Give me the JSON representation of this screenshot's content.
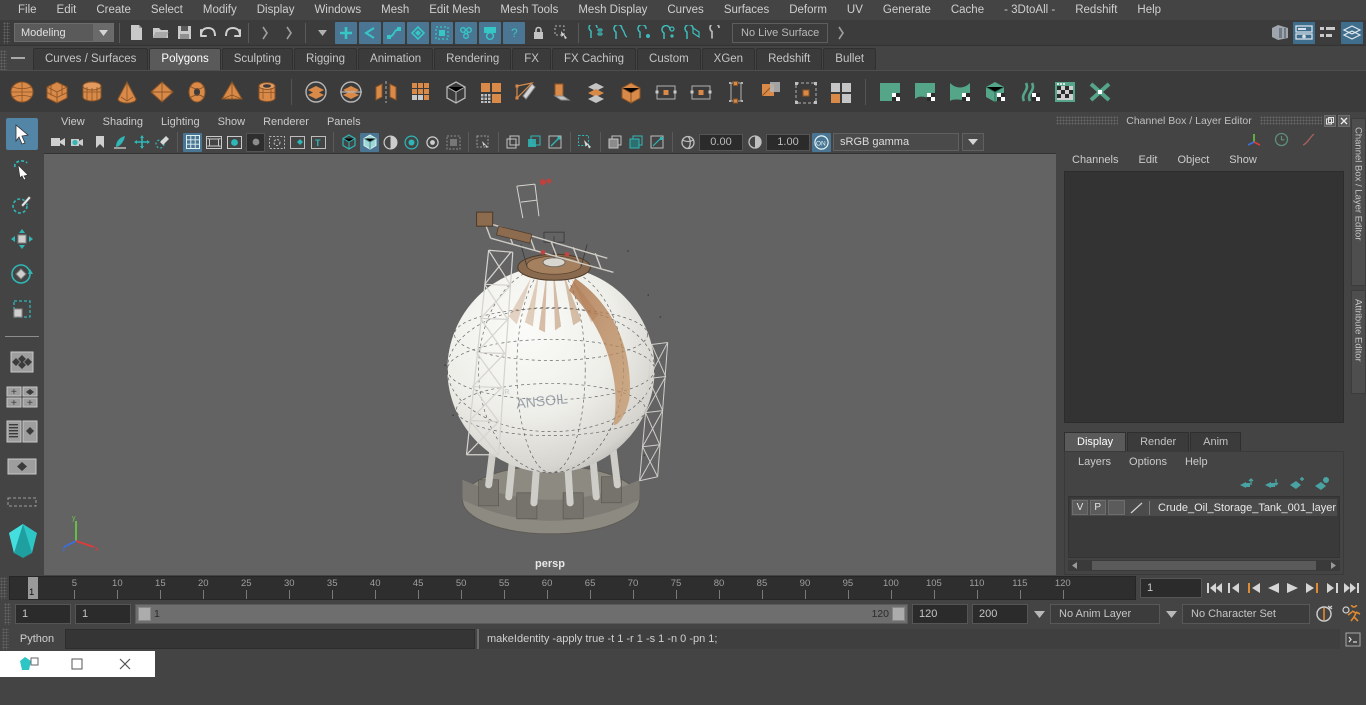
{
  "menubar": {
    "items": [
      "File",
      "Edit",
      "Create",
      "Select",
      "Modify",
      "Display",
      "Windows",
      "Mesh",
      "Edit Mesh",
      "Mesh Tools",
      "Mesh Display",
      "Curves",
      "Surfaces",
      "Deform",
      "UV",
      "Generate",
      "Cache",
      "- 3DtoAll -",
      "Redshift",
      "Help"
    ]
  },
  "statusline": {
    "menuset": "Modeling",
    "live_surface": "No Live Surface"
  },
  "shelf": {
    "tabs": [
      "Curves / Surfaces",
      "Polygons",
      "Sculpting",
      "Rigging",
      "Animation",
      "Rendering",
      "FX",
      "FX Caching",
      "Custom",
      "XGen",
      "Redshift",
      "Bullet"
    ],
    "active_tab": "Polygons"
  },
  "viewport": {
    "menus": [
      "View",
      "Shading",
      "Lighting",
      "Show",
      "Renderer",
      "Panels"
    ],
    "exposure": "0.00",
    "gamma_value": "1.00",
    "color_space": "sRGB gamma",
    "camera_label": "persp",
    "gizmo_axes": [
      "x",
      "y",
      "z"
    ]
  },
  "right_panel": {
    "title": "Channel Box / Layer Editor",
    "channel_menus": [
      "Channels",
      "Edit",
      "Object",
      "Show"
    ],
    "layer_tabs": [
      "Display",
      "Render",
      "Anim"
    ],
    "active_layer_tab": "Display",
    "layer_menus": [
      "Layers",
      "Options",
      "Help"
    ],
    "layers": [
      {
        "visibility": "V",
        "playback": "P",
        "name": "Crude_Oil_Storage_Tank_001_layer"
      }
    ],
    "vertical_tabs": [
      "Channel Box / Layer Editor",
      "Attribute Editor"
    ]
  },
  "timeslider": {
    "ticks": [
      5,
      10,
      15,
      20,
      25,
      30,
      35,
      40,
      45,
      50,
      55,
      60,
      65,
      70,
      75,
      80,
      85,
      90,
      95,
      100,
      105,
      110,
      115,
      120
    ],
    "current_frame": "1",
    "cursor_label": "1",
    "frame_field": "1"
  },
  "rangebar": {
    "start": "1",
    "end": "1",
    "handle_label": "1",
    "range_end_label": "120",
    "playback_end": "120",
    "anim_end": "200",
    "anim_layer": "No Anim Layer",
    "character_set": "No Character Set"
  },
  "commandline": {
    "language": "Python",
    "input_value": "",
    "output": "makeIdentity -apply true -t 1 -r 1 -s 1 -n 0 -pn 1;"
  },
  "taskbar": {
    "items": [
      "app-icon",
      "restore-icon",
      "close-icon"
    ]
  },
  "colors": {
    "accent_blue": "#4a7593",
    "shelf_orange": "#d98a49",
    "shelf_green": "#55a589",
    "panel_bg": "#444444",
    "viewport_bg": "#636363"
  }
}
